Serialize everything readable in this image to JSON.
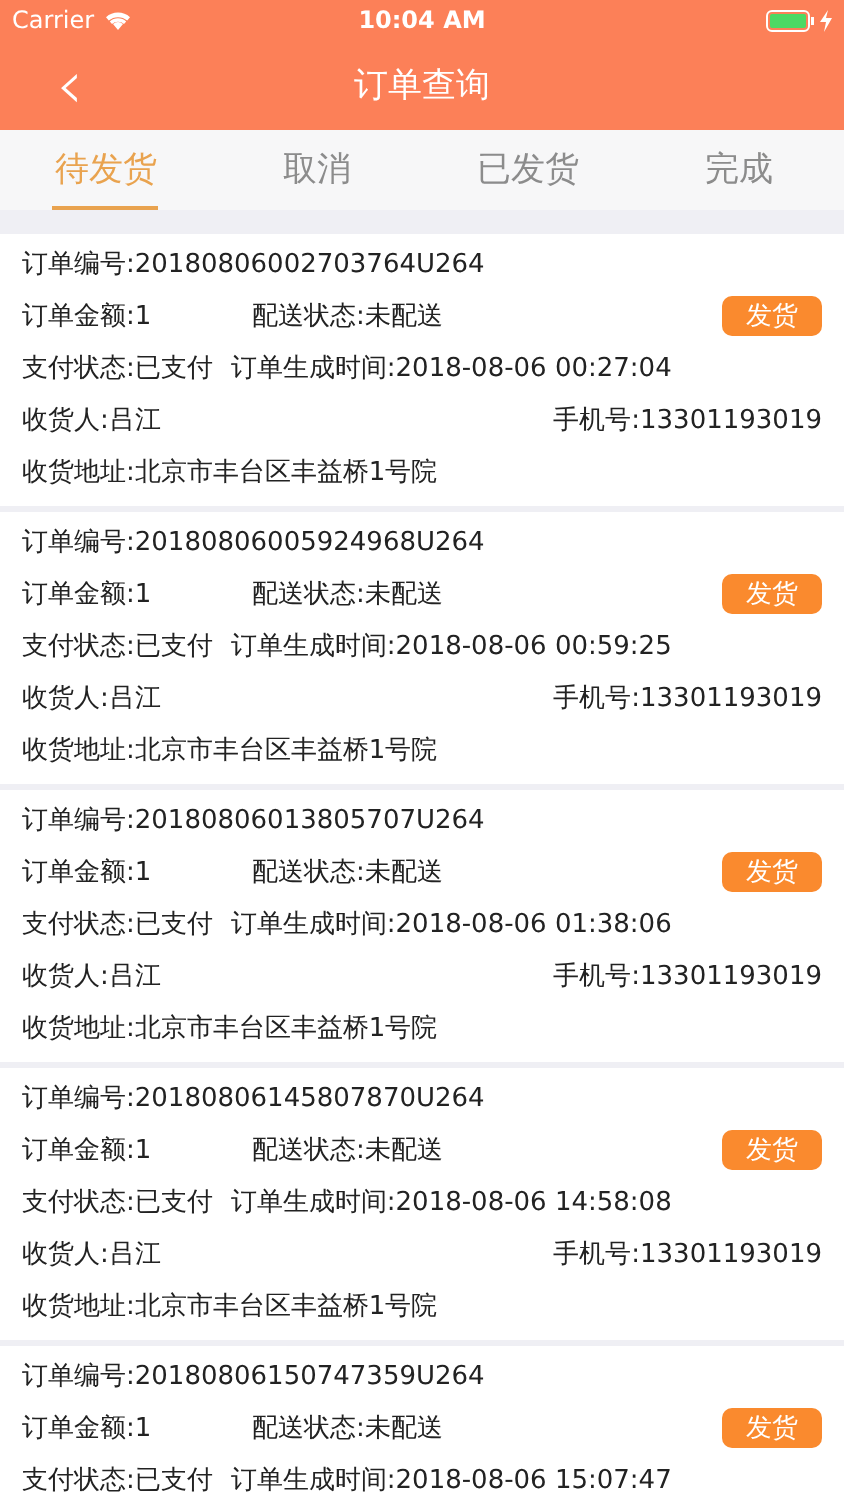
{
  "status_bar": {
    "carrier": "Carrier",
    "time": "10:04 AM"
  },
  "nav_bar": {
    "back": "‹",
    "title": "订单查询"
  },
  "tabs": [
    {
      "label": "待发货",
      "selected": true
    },
    {
      "label": "取消",
      "selected": false
    },
    {
      "label": "已发货",
      "selected": false
    },
    {
      "label": "完成",
      "selected": false
    }
  ],
  "orders": [
    {
      "order_no": "订单编号:20180806002703764U264",
      "amount": "订单金额:1",
      "delivery_status": "配送状态:未配送",
      "button": "发货",
      "pay_status": "支付状态:已支付",
      "created_time": "订单生成时间:2018-08-06 00:27:04",
      "consignee": "收货人:吕江",
      "phone": "手机号:13301193019",
      "address": "收货地址:北京市丰台区丰益桥1号院"
    },
    {
      "order_no": "订单编号:20180806005924968U264",
      "amount": "订单金额:1",
      "delivery_status": "配送状态:未配送",
      "button": "发货",
      "pay_status": "支付状态:已支付",
      "created_time": "订单生成时间:2018-08-06 00:59:25",
      "consignee": "收货人:吕江",
      "phone": "手机号:13301193019",
      "address": "收货地址:北京市丰台区丰益桥1号院"
    },
    {
      "order_no": "订单编号:20180806013805707U264",
      "amount": "订单金额:1",
      "delivery_status": "配送状态:未配送",
      "button": "发货",
      "pay_status": "支付状态:已支付",
      "created_time": "订单生成时间:2018-08-06 01:38:06",
      "consignee": "收货人:吕江",
      "phone": "手机号:13301193019",
      "address": "收货地址:北京市丰台区丰益桥1号院"
    },
    {
      "order_no": "订单编号:20180806145807870U264",
      "amount": "订单金额:1",
      "delivery_status": "配送状态:未配送",
      "button": "发货",
      "pay_status": "支付状态:已支付",
      "created_time": "订单生成时间:2018-08-06 14:58:08",
      "consignee": "收货人:吕江",
      "phone": "手机号:13301193019",
      "address": "收货地址:北京市丰台区丰益桥1号院"
    },
    {
      "order_no": "订单编号:20180806150747359U264",
      "amount": "订单金额:1",
      "delivery_status": "配送状态:未配送",
      "button": "发货",
      "pay_status": "支付状态:已支付",
      "created_time": "订单生成时间:2018-08-06 15:07:47"
    }
  ]
}
